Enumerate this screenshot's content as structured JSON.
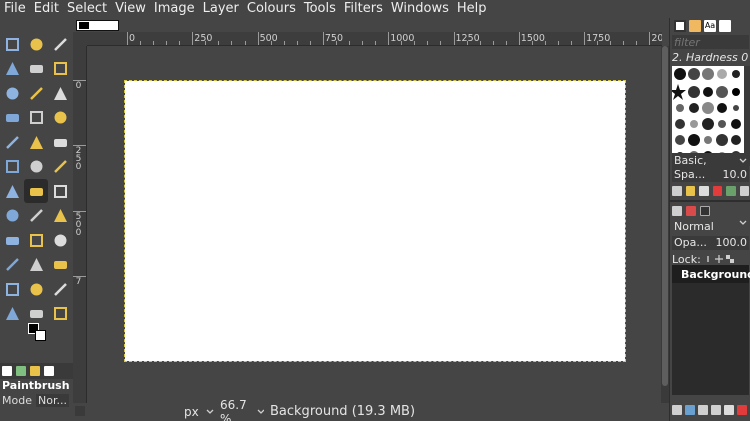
{
  "menubar": {
    "items": [
      "File",
      "Edit",
      "Select",
      "View",
      "Image",
      "Layer",
      "Colours",
      "Tools",
      "Filters",
      "Windows",
      "Help"
    ]
  },
  "toolbox": {
    "tools": [
      {
        "name": "move-tool",
        "icon": "move-icon",
        "active": false
      },
      {
        "name": "align-tool",
        "icon": "align-icon",
        "active": false
      },
      {
        "name": "rect-select-tool",
        "icon": "rect-select-icon",
        "active": false
      },
      {
        "name": "ellipse-select-tool",
        "icon": "ellipse-select-icon",
        "active": false
      },
      {
        "name": "free-select-tool",
        "icon": "lasso-icon",
        "active": false
      },
      {
        "name": "scissors-select-tool",
        "icon": "scissors-icon",
        "active": false
      },
      {
        "name": "fuzzy-select-tool",
        "icon": "magic-wand-icon",
        "active": false
      },
      {
        "name": "select-by-color-tool",
        "icon": "select-by-color-icon",
        "active": false
      },
      {
        "name": "foreground-select-tool",
        "icon": "foreground-select-icon",
        "active": false
      },
      {
        "name": "crop-tool",
        "icon": "crop-icon",
        "active": false
      },
      {
        "name": "rotate-tool",
        "icon": "rotate-icon",
        "active": false
      },
      {
        "name": "scale-tool",
        "icon": "scale-icon",
        "active": false
      },
      {
        "name": "shear-tool",
        "icon": "shear-icon",
        "active": false
      },
      {
        "name": "perspective-tool",
        "icon": "perspective-icon",
        "active": false
      },
      {
        "name": "flip-tool",
        "icon": "flip-icon",
        "active": false
      },
      {
        "name": "cage-tool",
        "icon": "cage-icon",
        "active": false
      },
      {
        "name": "warp-tool",
        "icon": "warp-icon",
        "active": false
      },
      {
        "name": "bucket-fill-tool",
        "icon": "bucket-icon",
        "active": false
      },
      {
        "name": "gradient-tool",
        "icon": "gradient-icon",
        "active": false
      },
      {
        "name": "paintbrush-tool",
        "icon": "paintbrush-icon",
        "active": true
      },
      {
        "name": "pencil-tool",
        "icon": "pencil-icon",
        "active": false
      },
      {
        "name": "airbrush-tool",
        "icon": "airbrush-icon",
        "active": false
      },
      {
        "name": "ink-tool",
        "icon": "ink-icon",
        "active": false
      },
      {
        "name": "mypaint-brush-tool",
        "icon": "mypaint-icon",
        "active": false
      },
      {
        "name": "eraser-tool",
        "icon": "eraser-icon",
        "active": false
      },
      {
        "name": "clone-tool",
        "icon": "clone-icon",
        "active": false
      },
      {
        "name": "perspective-clone-tool",
        "icon": "perspective-clone-icon",
        "active": false
      },
      {
        "name": "heal-tool",
        "icon": "heal-icon",
        "active": false
      },
      {
        "name": "smudge-tool",
        "icon": "smudge-icon",
        "active": false
      },
      {
        "name": "blur-tool",
        "icon": "blur-icon",
        "active": false
      },
      {
        "name": "dodge-burn-tool",
        "icon": "dodge-burn-icon",
        "active": false
      },
      {
        "name": "paths-tool",
        "icon": "paths-icon",
        "active": false
      },
      {
        "name": "text-tool",
        "icon": "text-icon",
        "active": false
      },
      {
        "name": "color-picker-tool",
        "icon": "eyedropper-icon",
        "active": false
      },
      {
        "name": "measure-tool",
        "icon": "measure-icon",
        "active": false
      },
      {
        "name": "zoom-tool",
        "icon": "zoom-icon",
        "active": false
      }
    ],
    "tool_name": "Paintbrush",
    "mode_label": "Mode",
    "mode_value": "Nor..."
  },
  "canvas": {
    "ruler_ticks": [
      "0",
      "250",
      "500",
      "750",
      "1000",
      "1250",
      "1500",
      "1750",
      "200"
    ],
    "ruler_left_ticks": [
      "0",
      "2 5 0",
      "5 0 0",
      "7"
    ],
    "background_color": "#ffffff"
  },
  "statusbar": {
    "unit": "px",
    "zoom": "66.7 %",
    "message": "Background (19.3 MB)"
  },
  "dock": {
    "filter_placeholder": "filter",
    "brush_name": "2. Hardness 0",
    "preset": "Basic,",
    "spacing_label": "Spa...",
    "spacing_value": "10.0",
    "mode_value": "Normal",
    "opacity_label": "Opa...",
    "opacity_value": "100.0",
    "lock_label": "Lock:",
    "layer_name": "Background"
  }
}
